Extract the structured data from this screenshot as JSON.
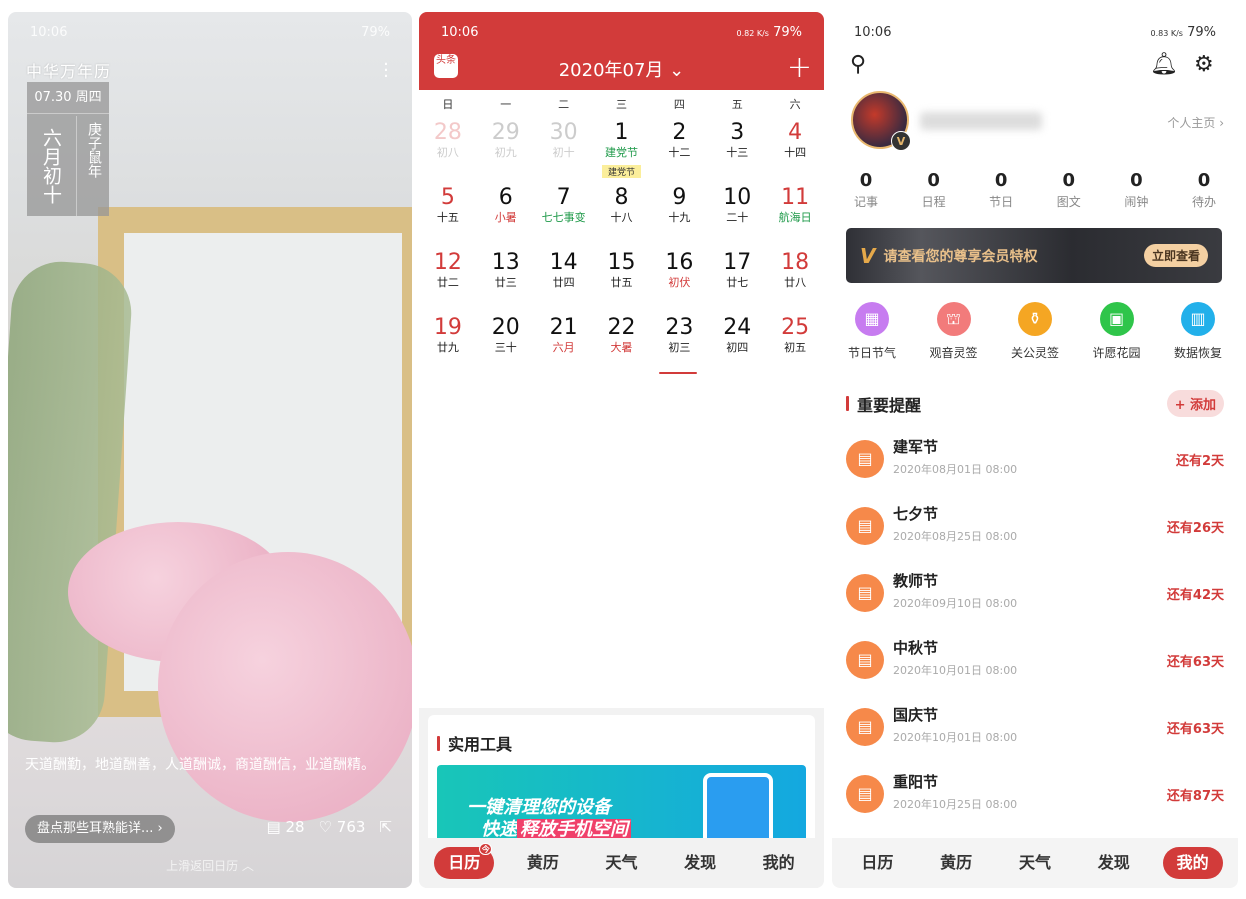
{
  "status": {
    "time": "10:06",
    "battery": "79%",
    "speed2": "0.82 K/s",
    "speed3": "0.83 K/s"
  },
  "screen1": {
    "app_name": "中华万年历",
    "date": "07.30 周四",
    "lunar": "六月初十",
    "year": "庚子鼠年",
    "quote": "天道酬勤，地道酬善，人道酬诚，商道酬信，业道酬精。",
    "article": "盘点那些耳熟能详...",
    "comments": "28",
    "likes": "763",
    "hint": "上滑返回日历 ︿"
  },
  "screen2": {
    "logo": "头条",
    "month": "2020年07月",
    "weekdays": [
      "日",
      "一",
      "二",
      "三",
      "四",
      "五",
      "六"
    ],
    "weeks": [
      [
        {
          "n": "28",
          "l": "初八",
          "dim": true,
          "red": true
        },
        {
          "n": "29",
          "l": "初九",
          "dim": true
        },
        {
          "n": "30",
          "l": "初十",
          "dim": true
        },
        {
          "n": "1",
          "l": "建党节",
          "lc": "g",
          "tag": "建党节"
        },
        {
          "n": "2",
          "l": "十二"
        },
        {
          "n": "3",
          "l": "十三"
        },
        {
          "n": "4",
          "l": "十四",
          "red": true
        }
      ],
      [
        {
          "n": "5",
          "l": "十五",
          "red": true
        },
        {
          "n": "6",
          "l": "小暑",
          "lc": "r"
        },
        {
          "n": "7",
          "l": "七七事变",
          "lc": "g"
        },
        {
          "n": "8",
          "l": "十八"
        },
        {
          "n": "9",
          "l": "十九"
        },
        {
          "n": "10",
          "l": "二十"
        },
        {
          "n": "11",
          "l": "航海日",
          "lc": "g",
          "red": true
        }
      ],
      [
        {
          "n": "12",
          "l": "廿二",
          "red": true
        },
        {
          "n": "13",
          "l": "廿三"
        },
        {
          "n": "14",
          "l": "廿四"
        },
        {
          "n": "15",
          "l": "廿五"
        },
        {
          "n": "16",
          "l": "初伏",
          "lc": "r"
        },
        {
          "n": "17",
          "l": "廿七"
        },
        {
          "n": "18",
          "l": "廿八",
          "red": true
        }
      ],
      [
        {
          "n": "19",
          "l": "廿九",
          "red": true
        },
        {
          "n": "20",
          "l": "三十"
        },
        {
          "n": "21",
          "l": "六月",
          "lc": "r"
        },
        {
          "n": "22",
          "l": "大暑",
          "lc": "r"
        },
        {
          "n": "23",
          "l": "初三"
        },
        {
          "n": "24",
          "l": "初四"
        },
        {
          "n": "25",
          "l": "初五",
          "red": true
        }
      ]
    ],
    "tools_title": "实用工具",
    "banner_line1": "一键清理您的设备",
    "banner_line2a": "快速",
    "banner_line2b": "释放手机空间"
  },
  "tabs": [
    "日历",
    "黄历",
    "天气",
    "发现",
    "我的"
  ],
  "tab_badge": "今",
  "screen3": {
    "home_link": "个人主页 ›",
    "stats": [
      {
        "v": "0",
        "k": "记事"
      },
      {
        "v": "0",
        "k": "日程"
      },
      {
        "v": "0",
        "k": "节日"
      },
      {
        "v": "0",
        "k": "图文"
      },
      {
        "v": "0",
        "k": "闹钟"
      },
      {
        "v": "0",
        "k": "待办"
      }
    ],
    "vip_text": "请查看您的尊享会员特权",
    "vip_button": "立即查看",
    "grid": [
      {
        "t": "节日节气",
        "color": "#c77cf0"
      },
      {
        "t": "观音灵签",
        "color": "#f27b7b"
      },
      {
        "t": "关公灵签",
        "color": "#f5a623"
      },
      {
        "t": "许愿花园",
        "color": "#2fc54a"
      },
      {
        "t": "数据恢复",
        "color": "#22b0ea"
      }
    ],
    "reminders_title": "重要提醒",
    "add_label": "+ 添加",
    "reminders": [
      {
        "name": "建军节",
        "date": "2020年08月01日  08:00",
        "left": "还有2天"
      },
      {
        "name": "七夕节",
        "date": "2020年08月25日  08:00",
        "left": "还有26天"
      },
      {
        "name": "教师节",
        "date": "2020年09月10日  08:00",
        "left": "还有42天"
      },
      {
        "name": "中秋节",
        "date": "2020年10月01日  08:00",
        "left": "还有63天"
      },
      {
        "name": "国庆节",
        "date": "2020年10月01日  08:00",
        "left": "还有63天"
      },
      {
        "name": "重阳节",
        "date": "2020年10月25日  08:00",
        "left": "还有87天"
      }
    ]
  }
}
